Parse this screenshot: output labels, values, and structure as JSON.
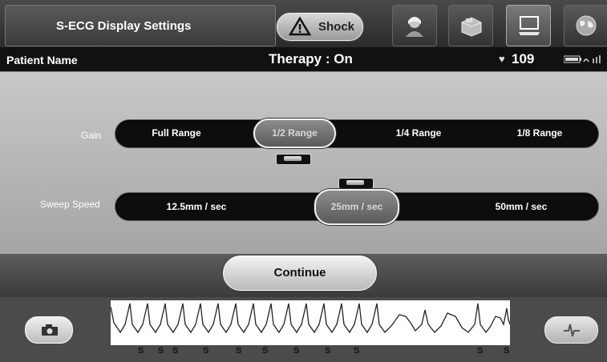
{
  "header": {
    "title": "S-ECG Display Settings",
    "shock_label": "Shock",
    "icons": [
      "patient-icon",
      "device-icon",
      "display-settings-icon",
      "globe-icon"
    ]
  },
  "status": {
    "patient_label": "Patient Name",
    "therapy": "Therapy : On",
    "heart_rate": "109"
  },
  "gain": {
    "label": "Gain",
    "options": [
      "Full Range",
      "1/2 Range",
      "1/4 Range",
      "1/8 Range"
    ],
    "selected": "1/2 Range"
  },
  "sweep": {
    "label": "Sweep Speed",
    "options": [
      "12.5mm / sec",
      "25mm / sec",
      "50mm / sec"
    ],
    "selected": "25mm / sec"
  },
  "footer": {
    "continue_label": "Continue"
  },
  "ecg": {
    "sense_marker": "S"
  }
}
